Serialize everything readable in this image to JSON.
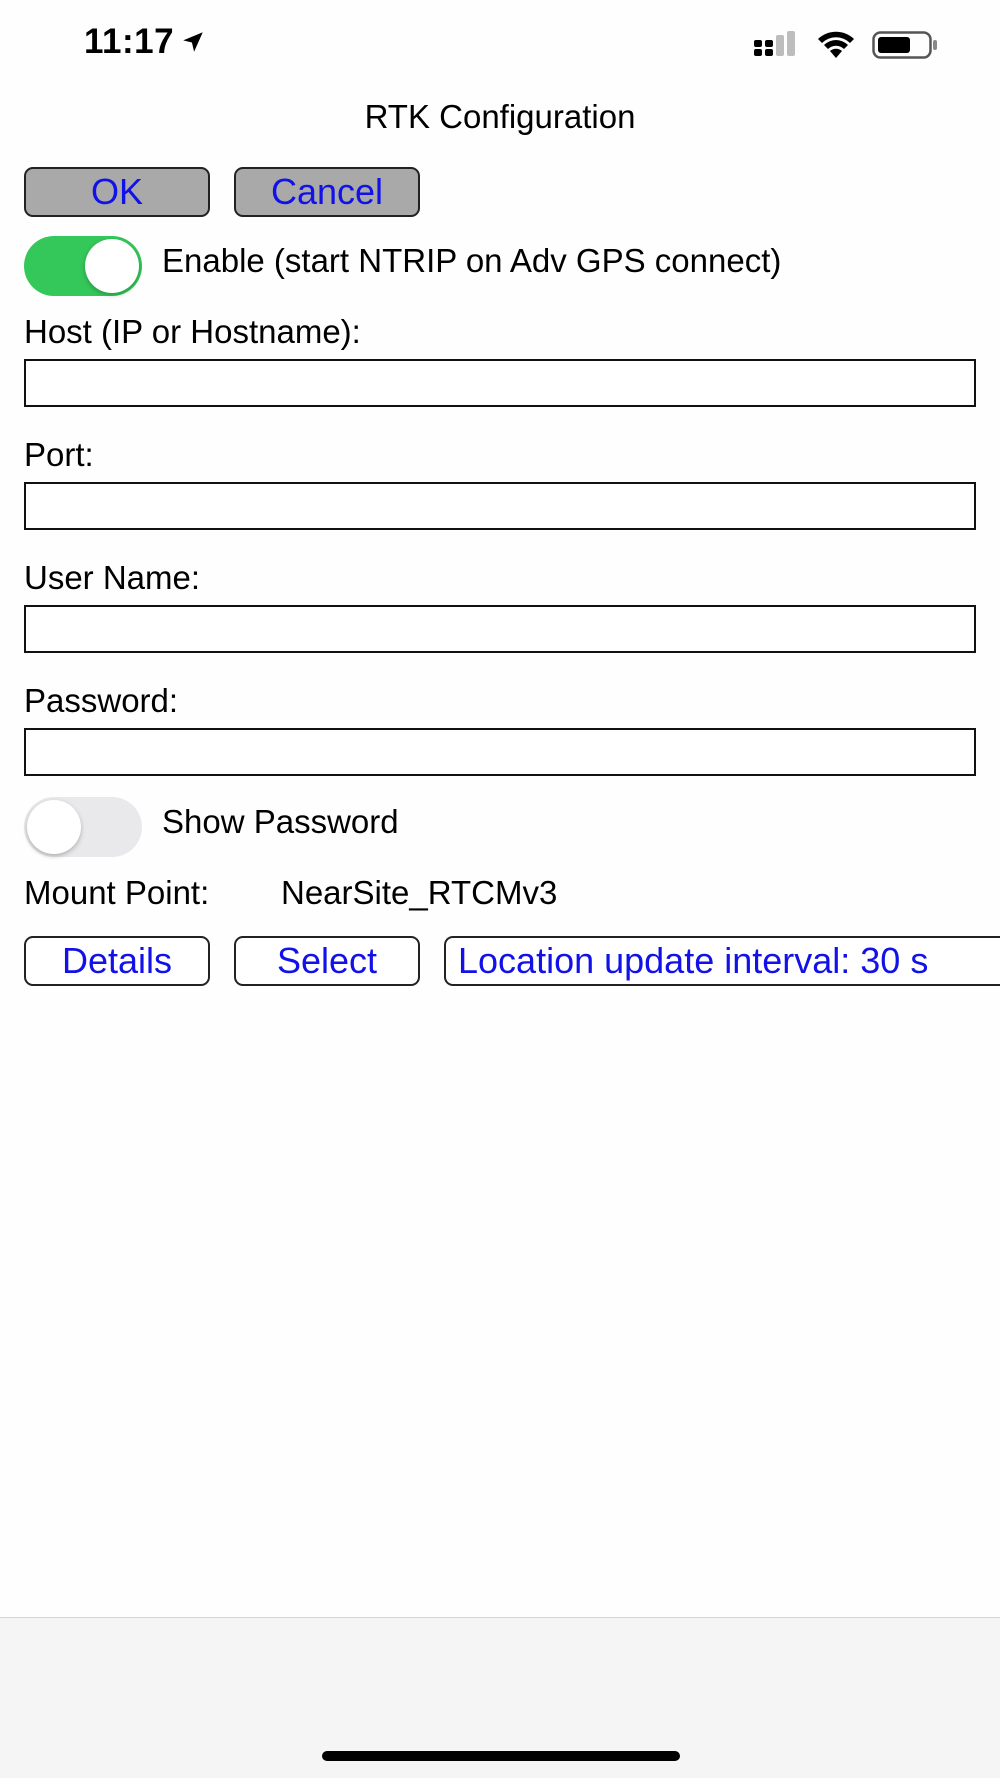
{
  "status_bar": {
    "time": "11:17",
    "icons": [
      "location-arrow-icon",
      "cellular-signal-icon",
      "wifi-icon",
      "battery-icon"
    ]
  },
  "title": "RTK Configuration",
  "buttons": {
    "ok": "OK",
    "cancel": "Cancel",
    "details": "Details",
    "select": "Select",
    "location_interval": "Location update interval: 30 s"
  },
  "enable": {
    "label": "Enable (start NTRIP on Adv GPS connect)",
    "on": true
  },
  "fields": {
    "host_label": "Host (IP or Hostname):",
    "host_value": "",
    "port_label": "Port:",
    "port_value": "",
    "username_label": "User Name:",
    "username_value": "",
    "password_label": "Password:",
    "password_value": ""
  },
  "show_password": {
    "label": "Show Password",
    "on": false
  },
  "mount_point": {
    "label": "Mount Point:",
    "value": "NearSite_RTCMv3"
  },
  "colors": {
    "button_text": "#1111e8",
    "toggle_on": "#34c759",
    "toggle_off": "#e9e9eb",
    "button_gray": "#a9a9a9"
  }
}
